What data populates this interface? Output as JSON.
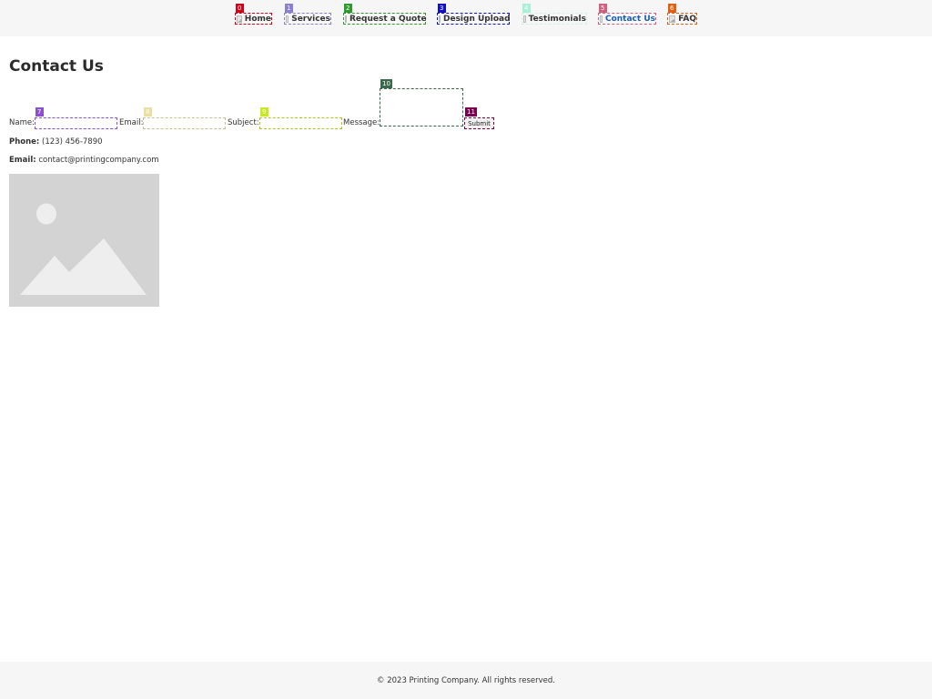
{
  "nav": {
    "items": [
      {
        "label": "Home",
        "mark": "0",
        "color": "#d0021b"
      },
      {
        "label": "Services",
        "mark": "1",
        "color": "#8a7fd0"
      },
      {
        "label": "Request a Quote",
        "mark": "2",
        "color": "#2e9a2e"
      },
      {
        "label": "Design Upload",
        "mark": "3",
        "color": "#1010c8"
      },
      {
        "label": "Testimonials",
        "mark": "4",
        "color": "#a8f0d8"
      },
      {
        "label": "Contact Us",
        "mark": "5",
        "color": "#d06080"
      },
      {
        "label": "FAQ",
        "mark": "6",
        "color": "#e06010"
      }
    ],
    "active_index": 5,
    "active_color": "#1a5fb4"
  },
  "page": {
    "title": "Contact Us"
  },
  "form": {
    "name_label": "Name:",
    "email_label": "Email:",
    "subject_label": "Subject:",
    "message_label": "Message:",
    "submit_label": "Submit",
    "marks": {
      "name": {
        "mark": "7",
        "color": "#8a50d0"
      },
      "email": {
        "mark": "8",
        "color": "#e8e0a0"
      },
      "subject": {
        "mark": "9",
        "color": "#c8e820"
      },
      "message": {
        "mark": "10",
        "color": "#3a6a4a"
      },
      "submit": {
        "mark": "11",
        "color": "#7a0050"
      }
    }
  },
  "contact": {
    "phone_label": "Phone:",
    "phone_value": "(123) 456-7890",
    "email_label": "Email:",
    "email_value": "contact@printingcompany.com"
  },
  "image": {
    "icon": "image-placeholder-icon"
  },
  "footer": {
    "text": "© 2023 Printing Company. All rights reserved."
  }
}
